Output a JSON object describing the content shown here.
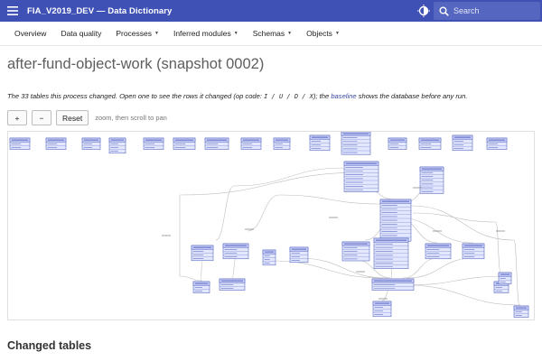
{
  "app": {
    "title": "FIA_V2019_DEV — Data Dictionary",
    "menu_icon": "menu-icon",
    "theme_icon": "theme-toggle-icon",
    "search": {
      "placeholder": "Search",
      "icon": "search-icon"
    }
  },
  "nav": {
    "items": [
      {
        "label": "Overview",
        "dropdown": false
      },
      {
        "label": "Data quality",
        "dropdown": false
      },
      {
        "label": "Processes",
        "dropdown": true
      },
      {
        "label": "Inferred modules",
        "dropdown": true
      },
      {
        "label": "Schemas",
        "dropdown": true
      },
      {
        "label": "Objects",
        "dropdown": true
      }
    ]
  },
  "page": {
    "title": "after-fund-object-work (snapshot 0002)",
    "description": {
      "part1": "The 33 tables this process changed. Open one to see the rows it changed (op code: ",
      "codes": "I / U / D / X",
      "part2": "); the ",
      "link": "baseline",
      "part3": " shows the database before any run."
    },
    "controls": {
      "zoom_in": "+",
      "zoom_out": "−",
      "reset": "Reset",
      "hint": "zoom, then scroll to pan"
    },
    "section_title": "Changed tables"
  },
  "diagram": {
    "table_count": 33,
    "colors": {
      "fill": "#e4e8ff",
      "stroke": "#3f51b5",
      "header": "#c5cbf7",
      "edge": "#bdbdbd",
      "label": "#666666"
    },
    "tables_top_row": 15,
    "tables_graph": 18
  }
}
